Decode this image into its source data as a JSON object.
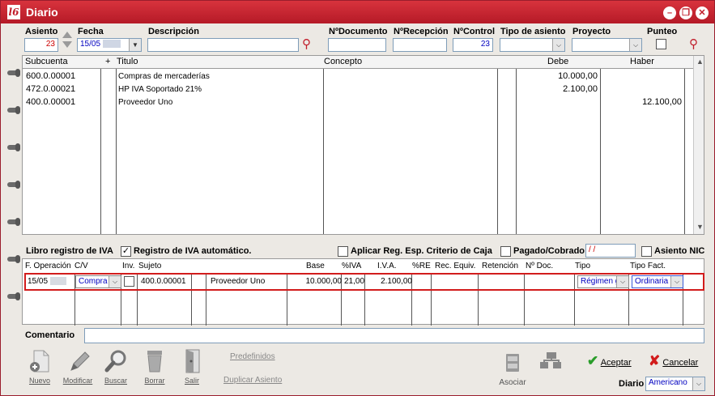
{
  "window": {
    "logo": "l6",
    "title": "Diario",
    "controls": {
      "minimize": "–",
      "restore": "❐",
      "close": "✕"
    }
  },
  "header": {
    "asiento_label": "Asiento",
    "asiento_value": "23",
    "fecha_label": "Fecha",
    "fecha_value": "15/05",
    "descripcion_label": "Descripción",
    "descripcion_value": "",
    "documento_label": "NºDocumento",
    "documento_value": "",
    "recepcion_label": "NºRecepción",
    "recepcion_value": "",
    "control_label": "NºControl",
    "control_value": "23",
    "tipo_asiento_label": "Tipo de asiento",
    "tipo_asiento_value": "",
    "proyecto_label": "Proyecto",
    "proyecto_value": "",
    "punteo_label": "Punteo"
  },
  "entries": {
    "columns": {
      "subcuenta": "Subcuenta",
      "plus": "+",
      "titulo": "Titulo",
      "concepto": "Concepto",
      "debe": "Debe",
      "haber": "Haber"
    },
    "rows": [
      {
        "subcuenta": "600.0.00001",
        "titulo": "Compras de mercaderías",
        "concepto": "",
        "debe": "10.000,00",
        "haber": ""
      },
      {
        "subcuenta": "472.0.00021",
        "titulo": "HP IVA Soportado 21%",
        "concepto": "",
        "debe": "2.100,00",
        "haber": ""
      },
      {
        "subcuenta": "400.0.00001",
        "titulo": "Proveedor Uno",
        "concepto": "",
        "debe": "",
        "haber": "12.100,00"
      }
    ]
  },
  "iva_section": {
    "libro_label": "Libro registro de IVA",
    "registro_auto_label": "Registro de IVA automático.",
    "registro_auto_checked": "✓",
    "criterio_caja_label": "Aplicar Reg. Esp. Criterio de Caja",
    "pagado_label": "Pagado/Cobrado",
    "pagado_value": " / /",
    "asiento_nic_label": "Asiento NIC",
    "columns": {
      "f_operacion": "F. Operación",
      "cv": "C/V",
      "inv": "Inv.",
      "sujeto": "Sujeto",
      "base": "Base",
      "pct_iva": "%IVA",
      "iva": "I.V.A.",
      "pct_re": "%RE",
      "rec_equiv": "Rec. Equiv.",
      "retencion": "Retención",
      "num_doc": "Nº Doc.",
      "tipo": "Tipo",
      "tipo_fact": "Tipo Fact."
    },
    "row": {
      "f_operacion": "15/05",
      "cv": "Compra",
      "sujeto_code": "400.0.00001",
      "sujeto_name": "Proveedor Uno",
      "base": "10.000,00",
      "pct_iva": "21,00",
      "iva": "2.100,00",
      "tipo": "Régimen g",
      "tipo_fact": "Ordinaria"
    }
  },
  "comentario": {
    "label": "Comentario",
    "value": ""
  },
  "toolbar": {
    "nuevo": "Nuevo",
    "modificar": "Modificar",
    "buscar": "Buscar",
    "borrar": "Borrar",
    "salir": "Salir",
    "predefinidos": "Predefinidos",
    "duplicar": "Duplicar Asiento",
    "asociar": "Asociar",
    "aceptar": "Aceptar",
    "cancelar": "Cancelar",
    "diario_label": "Diario",
    "diario_value": "Americano"
  },
  "colors": {
    "brand": "#c11d2a",
    "highlight_box": "#d21c1c"
  }
}
